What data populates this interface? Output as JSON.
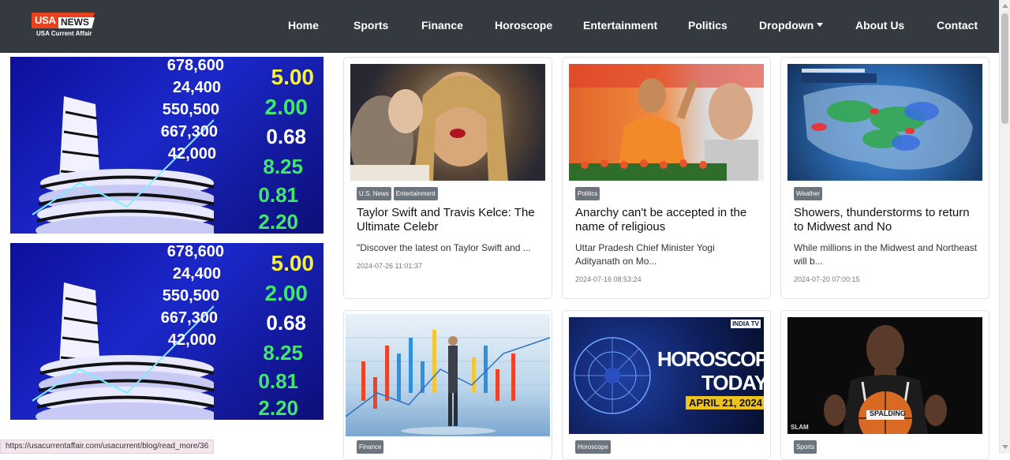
{
  "logo": {
    "brand_a": "USA",
    "brand_b": "NEWS",
    "tagline": "USA Current Affair"
  },
  "nav": {
    "items": [
      "Home",
      "Sports",
      "Finance",
      "Horoscope",
      "Entertainment",
      "Politics",
      "Dropdown",
      "About Us",
      "Contact"
    ]
  },
  "sidebar": {
    "image_numbers": [
      "678,600",
      "24,400",
      "550,500",
      "667,300",
      "42,000",
      "5.00",
      "2.00",
      "0.68",
      "8.25",
      "0.81",
      "2.20"
    ]
  },
  "cards": [
    {
      "tags": [
        "U.S. News",
        "Entertainment"
      ],
      "title": "Taylor Swift and Travis Kelce: The Ultimate Celebr",
      "desc": "\"Discover the latest on Taylor Swift and ...",
      "date": "2024-07-26 11:01:37"
    },
    {
      "tags": [
        "Politics"
      ],
      "title": "Anarchy can't be accepted in the name of religious",
      "desc": "Uttar Pradesh Chief Minister Yogi Adityanath on Mo...",
      "date": "2024-07-16 08:53:24"
    },
    {
      "tags": [
        "Weather"
      ],
      "title": "Showers, thunderstorms to return to Midwest and No",
      "desc": "While millions in the Midwest and Northeast will b...",
      "date": "2024-07-20 07:00:15"
    },
    {
      "tags": [
        "Finance"
      ]
    },
    {
      "tags": [
        "Horoscope"
      ],
      "image_text": {
        "logo": "INDIA TV",
        "headline_a": "HOROSCOPE",
        "headline_b": "TODAY",
        "date": "APRIL 21, 2024"
      }
    },
    {
      "tags": [
        "Sports"
      ],
      "image_text": {
        "watermark": "SLAM",
        "ball": "SPALDING"
      }
    }
  ],
  "status_bar": {
    "url": "https://usacurrentaffair.com/usacurrent/blog/read_more/36"
  },
  "colors": {
    "navbar": "#343a40",
    "tag": "#6c757d",
    "logo_red": "#e8421f"
  }
}
